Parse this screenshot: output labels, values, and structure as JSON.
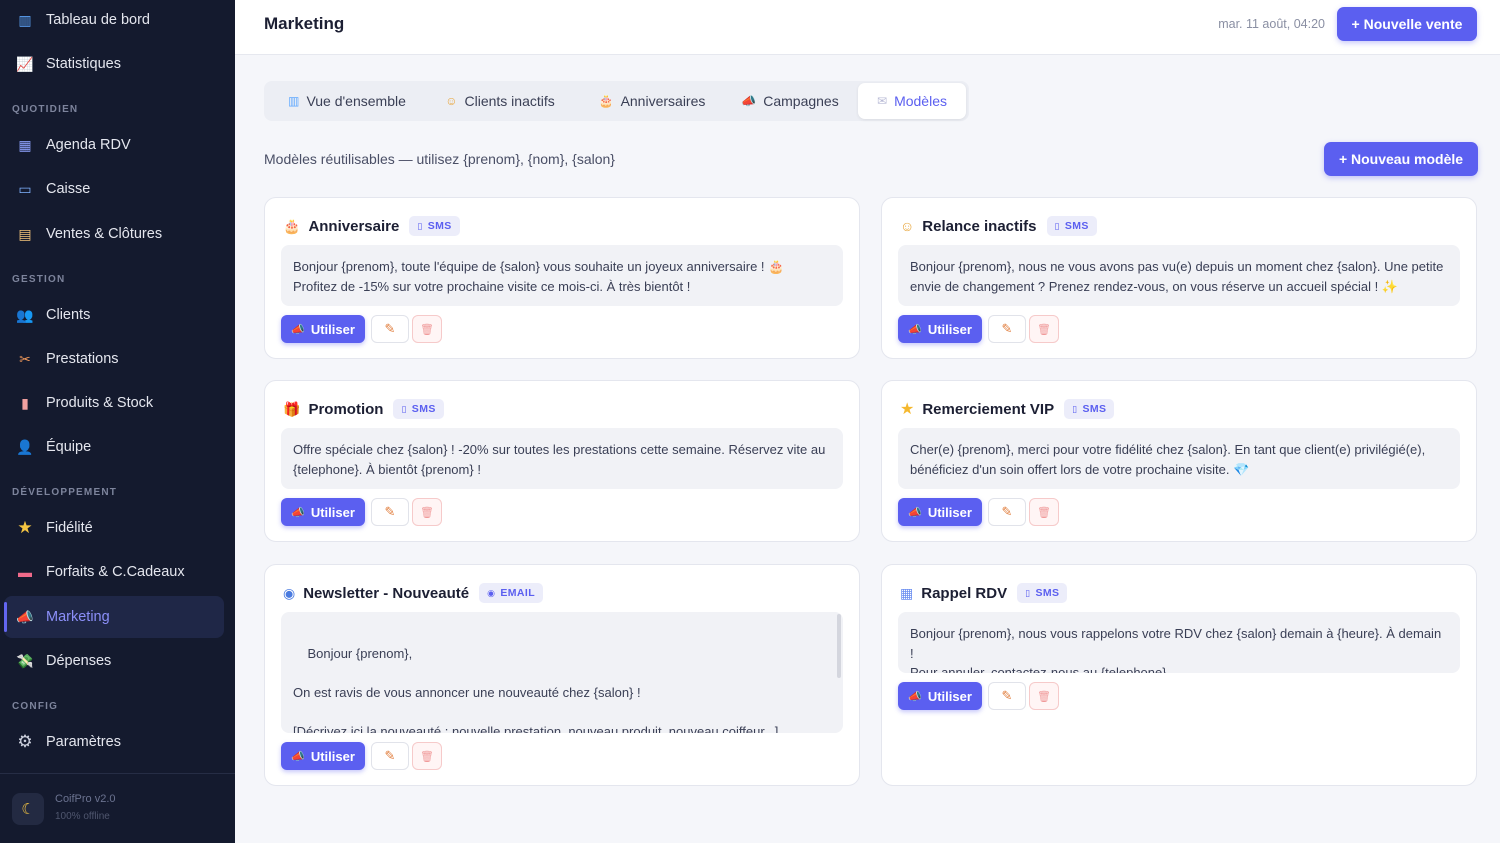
{
  "sidebar": {
    "items": [
      {
        "label": "Tableau de bord",
        "icon": "bar-chart-icon",
        "glyph": "▥"
      },
      {
        "label": "Statistiques",
        "icon": "trend-chart-icon",
        "glyph": "📈"
      },
      {
        "label": "Agenda RDV",
        "icon": "calendar-icon",
        "glyph": "▦"
      },
      {
        "label": "Caisse",
        "icon": "credit-card-icon",
        "glyph": "▭"
      },
      {
        "label": "Ventes & Clôtures",
        "icon": "receipt-icon",
        "glyph": "▤"
      },
      {
        "label": "Clients",
        "icon": "users-icon",
        "glyph": "👥"
      },
      {
        "label": "Prestations",
        "icon": "stylist-icon",
        "glyph": "✂"
      },
      {
        "label": "Produits & Stock",
        "icon": "bottle-icon",
        "glyph": "▮"
      },
      {
        "label": "Équipe",
        "icon": "team-icon",
        "glyph": "👤"
      },
      {
        "label": "Fidélité",
        "icon": "star-icon",
        "glyph": "★"
      },
      {
        "label": "Forfaits & C.Cadeaux",
        "icon": "ticket-icon",
        "glyph": "▬"
      },
      {
        "label": "Marketing",
        "icon": "megaphone-icon",
        "glyph": "📣"
      },
      {
        "label": "Dépenses",
        "icon": "money-wings-icon",
        "glyph": "💸"
      },
      {
        "label": "Paramètres",
        "icon": "gear-icon",
        "glyph": "⚙"
      }
    ],
    "sections": {
      "quotidien": "QUOTIDIEN",
      "gestion": "GESTION",
      "developpement": "DÉVELOPPEMENT",
      "config": "CONFIG"
    },
    "footer": {
      "app_name": "CoifPro v2.0",
      "status": "100% offline",
      "theme_glyph": "☾"
    }
  },
  "header": {
    "title": "Marketing",
    "date": "mar. 11 août, 04:20",
    "new_sale_label": "+ Nouvelle vente"
  },
  "tabs": [
    {
      "label": "Vue d'ensemble",
      "icon": "chart-icon",
      "glyph": "▥"
    },
    {
      "label": "Clients inactifs",
      "icon": "sleepy-face-icon",
      "glyph": "☺"
    },
    {
      "label": "Anniversaires",
      "icon": "cake-icon",
      "glyph": "🎂"
    },
    {
      "label": "Campagnes",
      "icon": "megaphone-icon",
      "glyph": "📣"
    },
    {
      "label": "Modèles",
      "icon": "envelope-icon",
      "glyph": "✉"
    }
  ],
  "active_tab": "Modèles",
  "subtitle": "Modèles réutilisables — utilisez {prenom}, {nom}, {salon}",
  "new_template_label": "+ Nouveau modèle",
  "actions": {
    "use_label": "Utiliser",
    "use_glyph": "📣",
    "edit_glyph": "✎",
    "delete_glyph": "🗑"
  },
  "templates": [
    {
      "title": "Anniversaire",
      "icon": "cake-icon",
      "glyph": "🎂",
      "channel": "SMS",
      "channel_glyph": "▯",
      "message": "Bonjour {prenom}, toute l'équipe de {salon} vous souhaite un joyeux anniversaire ! 🎂\nProfitez de -15% sur votre prochaine visite ce mois-ci. À très bientôt !"
    },
    {
      "title": "Relance inactifs",
      "icon": "sleepy-face-icon",
      "glyph": "☺",
      "channel": "SMS",
      "channel_glyph": "▯",
      "message": "Bonjour {prenom}, nous ne vous avons pas vu(e) depuis un moment chez {salon}. Une petite envie de changement ? Prenez rendez-vous, on vous réserve un accueil spécial ! ✨"
    },
    {
      "title": "Promotion",
      "icon": "gift-icon",
      "glyph": "🎁",
      "channel": "SMS",
      "channel_glyph": "▯",
      "message": "Offre spéciale chez {salon} ! -20% sur toutes les prestations cette semaine. Réservez vite au {telephone}. À bientôt {prenom} !"
    },
    {
      "title": "Remerciement VIP",
      "icon": "star-icon",
      "glyph": "★",
      "channel": "SMS",
      "channel_glyph": "▯",
      "message": "Cher(e) {prenom}, merci pour votre fidélité chez {salon}. En tant que client(e) privilégié(e), bénéficiez d'un soin offert lors de votre prochaine visite. 💎"
    },
    {
      "title": "Newsletter - Nouveauté",
      "icon": "newsletter-icon",
      "glyph": "◉",
      "channel": "EMAIL",
      "channel_glyph": "◉",
      "message": "Bonjour {prenom},\n\nOn est ravis de vous annoncer une nouveauté chez {salon} !\n\n[Décrivez ici la nouveauté : nouvelle prestation, nouveau produit, nouveau coiffeur...]"
    },
    {
      "title": "Rappel RDV",
      "icon": "calendar-icon",
      "glyph": "▦",
      "channel": "SMS",
      "channel_glyph": "▯",
      "message": "Bonjour {prenom}, nous vous rappelons votre RDV chez {salon} demain à {heure}. À demain !\nPour annuler, contactez-nous au {telephone}."
    }
  ],
  "colors": {
    "accent": "#5b5ff0",
    "sidebar_bg": "#141a2e",
    "page_bg": "#f5f6fa"
  }
}
